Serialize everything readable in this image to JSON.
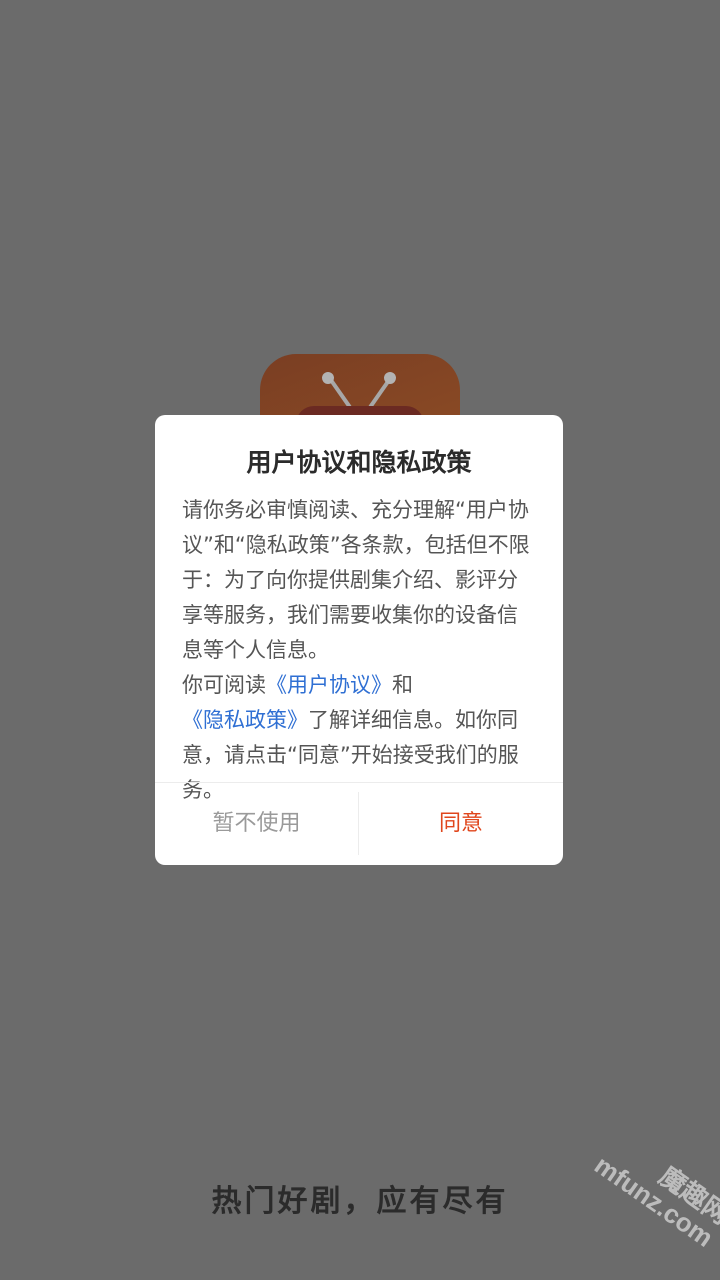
{
  "splash": {
    "tagline": "热门好剧，应有尽有"
  },
  "watermark": {
    "line1": "魔趣网",
    "line2": "mfunz.com"
  },
  "dialog": {
    "title": "用户协议和隐私政策",
    "paragraph1": "请你务必审慎阅读、充分理解“用户协议”和“隐私政策”各条款，包括但不限于：为了向你提供剧集介绍、影评分享等服务，我们需要收集你的设备信息等个人信息。",
    "paragraph2_prefix": "你可阅读",
    "user_agreement_link": "《用户协议》",
    "paragraph2_and": "和",
    "privacy_policy_link": "《隐私政策》",
    "paragraph2_suffix": "了解详细信息。如你同意，请点击“同意”开始接受我们的服务。",
    "decline_label": "暂不使用",
    "agree_label": "同意"
  },
  "colors": {
    "overlay_background": "#6b6b6b",
    "link": "#2f6fd3",
    "agree": "#e0461c",
    "decline": "#9a9a9a"
  },
  "icons": {
    "app_logo": "tv-icon"
  }
}
